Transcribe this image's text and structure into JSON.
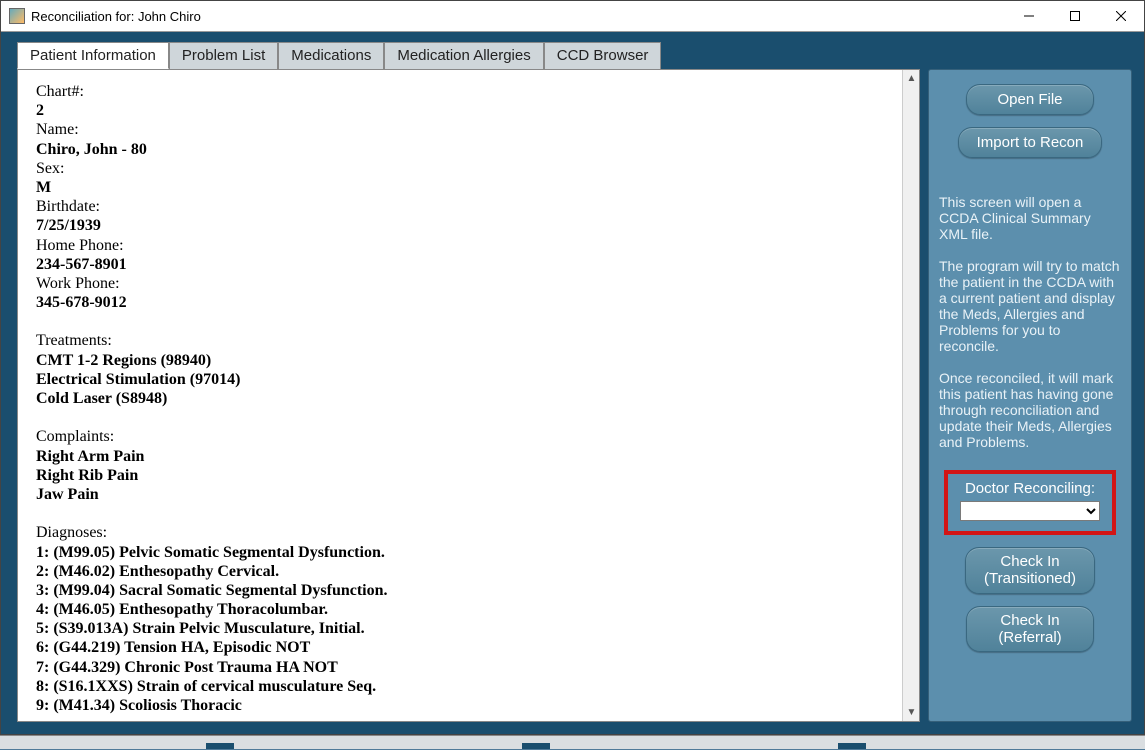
{
  "window": {
    "title": "Reconciliation for: John Chiro"
  },
  "tabs": [
    {
      "label": "Patient Information",
      "active": true
    },
    {
      "label": "Problem List"
    },
    {
      "label": "Medications"
    },
    {
      "label": "Medication Allergies"
    },
    {
      "label": "CCD Browser"
    }
  ],
  "patient": {
    "chart_label": "Chart#:",
    "chart": "2",
    "name_label": "Name:",
    "name": "Chiro, John - 80",
    "sex_label": "Sex:",
    "sex": "M",
    "birthdate_label": "Birthdate:",
    "birthdate": "7/25/1939",
    "home_phone_label": "Home Phone:",
    "home_phone": "234-567-8901",
    "work_phone_label": "Work Phone:",
    "work_phone": "345-678-9012",
    "treatments_label": "Treatments:",
    "treatments": [
      "CMT 1-2 Regions (98940)",
      "Electrical Stimulation (97014)",
      "Cold Laser (S8948)"
    ],
    "complaints_label": "Complaints:",
    "complaints": [
      "Right Arm Pain",
      "Right Rib Pain",
      "Jaw Pain"
    ],
    "diagnoses_label": "Diagnoses:",
    "diagnoses": [
      "1: (M99.05) Pelvic Somatic Segmental Dysfunction.",
      "2: (M46.02) Enthesopathy Cervical.",
      "3: (M99.04) Sacral Somatic Segmental Dysfunction.",
      "4: (M46.05) Enthesopathy Thoracolumbar.",
      "5: (S39.013A) Strain Pelvic Musculature, Initial.",
      "6: (G44.219) Tension HA, Episodic NOT",
      "7: (G44.329) Chronic Post Trauma HA NOT",
      "8: (S16.1XXS) Strain of cervical musculature Seq.",
      "9: (M41.34) Scoliosis Thoracic"
    ]
  },
  "side": {
    "open_file": "Open File",
    "import": "Import to Recon",
    "para1": "This screen will open a CCDA Clinical Summary XML file.",
    "para2": "The program will try to match the patient in the CCDA with a current patient and display the Meds, Allergies and Problems for you to reconcile.",
    "para3": "Once reconciled, it will mark this patient has having gone through reconciliation and update their Meds, Allergies and Problems.",
    "doctor_label": "Doctor Reconciling:",
    "doctor_value": "",
    "checkin_trans_l1": "Check In",
    "checkin_trans_l2": "(Transitioned)",
    "checkin_ref_l1": "Check In",
    "checkin_ref_l2": "(Referral)"
  }
}
